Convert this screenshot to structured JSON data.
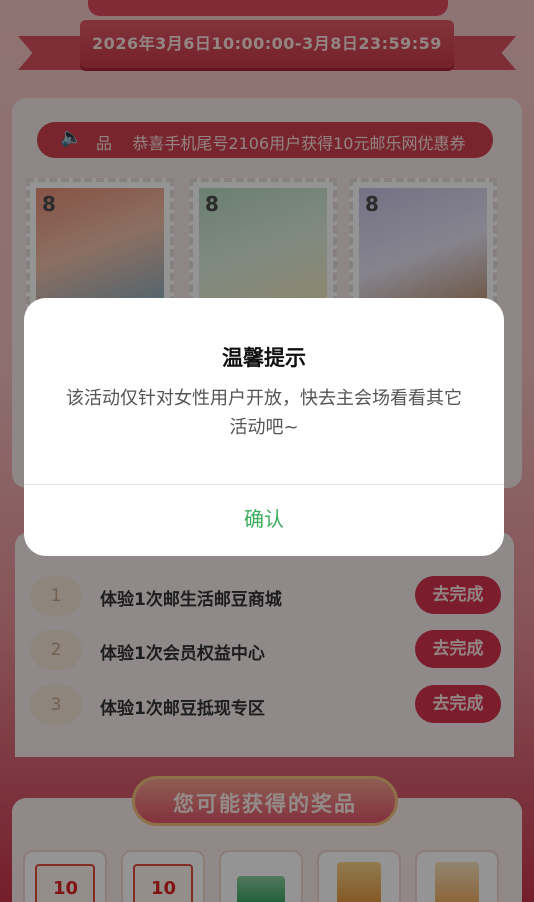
{
  "banner": {
    "date_range": "2026年3月6日10:00:00-3月8日23:59:59"
  },
  "notice": {
    "icon": "speaker-icon",
    "prefix": "品",
    "text": "恭喜手机尾号2106用户获得10元邮乐网优惠券"
  },
  "stamps": [
    {
      "value": "8"
    },
    {
      "value": "8"
    },
    {
      "value": "8"
    }
  ],
  "tasks": [
    {
      "index": "1",
      "label": "体验1次邮生活邮豆商城",
      "action": "去完成"
    },
    {
      "index": "2",
      "label": "体验1次会员权益中心",
      "action": "去完成"
    },
    {
      "index": "3",
      "label": "体验1次邮豆抵现专区",
      "action": "去完成"
    }
  ],
  "prizes": {
    "title": "您可能获得的奖品",
    "items": [
      {
        "type": "coupon",
        "value": "10"
      },
      {
        "type": "coupon",
        "value": "10"
      },
      {
        "type": "card"
      },
      {
        "type": "box"
      },
      {
        "type": "gift"
      }
    ]
  },
  "dialog": {
    "title": "温馨提示",
    "message": "该活动仅针对女性用户开放，快去主会场看看其它活动吧~",
    "confirm_label": "确认",
    "confirm_color": "#3aae5c"
  }
}
